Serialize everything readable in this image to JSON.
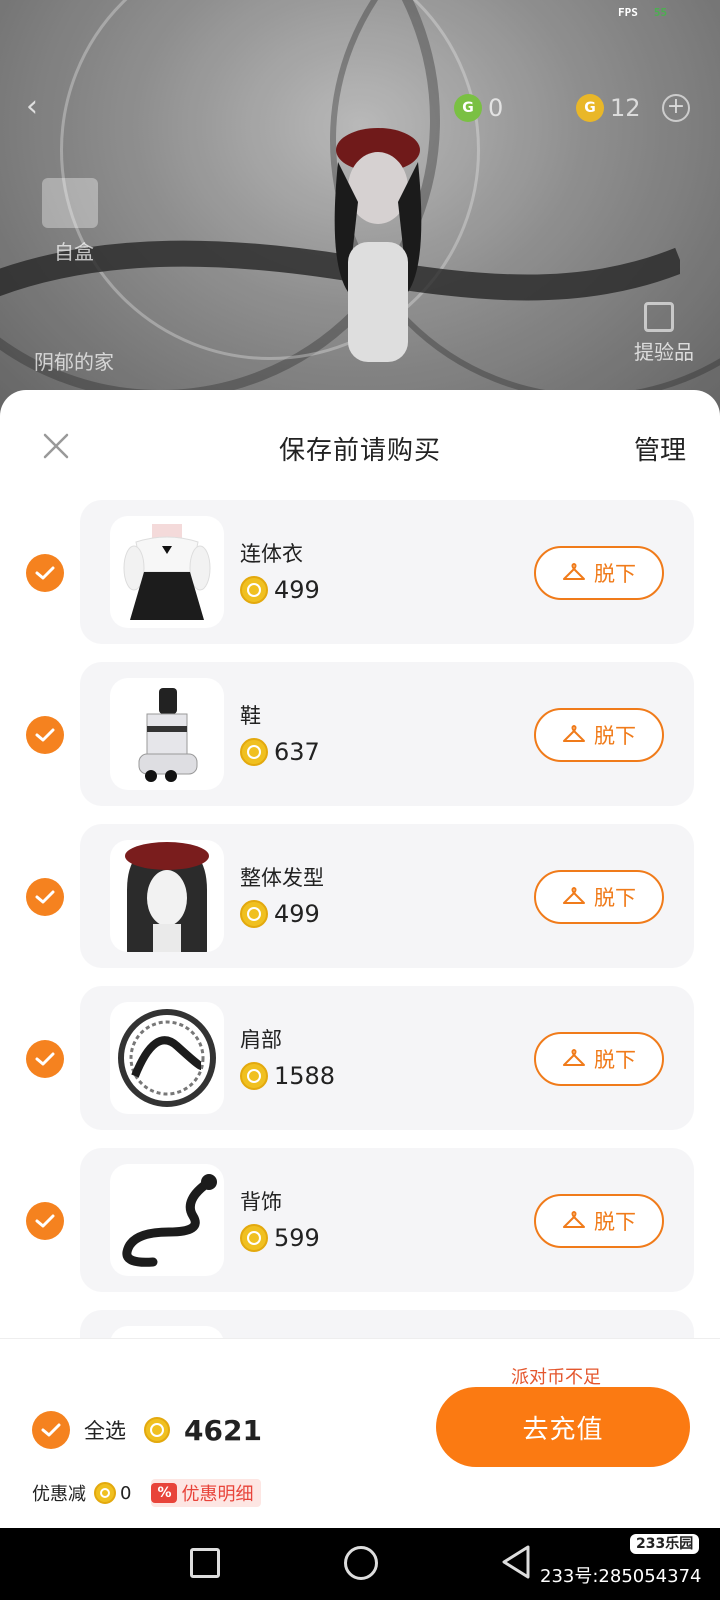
{
  "status": {
    "fps_label": "FPS",
    "fps_value": "55"
  },
  "scene": {
    "currency_green": "0",
    "currency_gold": "12",
    "gift_label": "自盒",
    "left_label": "阴郁的家",
    "right_label": "提验品"
  },
  "sheet": {
    "title": "保存前请购买",
    "manage_label": "管理",
    "remove_label": "脱下",
    "items": [
      {
        "name": "连体衣",
        "price": "499"
      },
      {
        "name": "鞋",
        "price": "637"
      },
      {
        "name": "整体发型",
        "price": "499"
      },
      {
        "name": "肩部",
        "price": "1588"
      },
      {
        "name": "背饰",
        "price": "599"
      }
    ]
  },
  "footer": {
    "insufficient_text": "派对币不足",
    "select_all_label": "全选",
    "total": "4621",
    "discount_label": "优惠减",
    "discount_value": "0",
    "pct_badge": "%",
    "discount_detail_label": "优惠明细",
    "recharge_label": "去充值"
  },
  "watermark": {
    "logo": "233乐园",
    "text": "233号:285054374"
  },
  "colors": {
    "accent": "#f5821f",
    "warning": "#e4572e",
    "coin": "#f0c020"
  }
}
